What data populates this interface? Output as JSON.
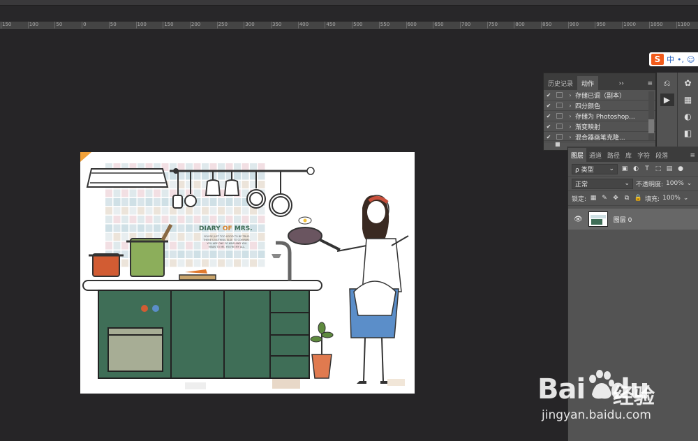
{
  "ruler": {
    "labels": [
      "150",
      "100",
      "50",
      "0",
      "50",
      "100",
      "150",
      "200",
      "250",
      "300",
      "350",
      "400",
      "450",
      "500",
      "550",
      "600",
      "650",
      "700",
      "750",
      "800",
      "850",
      "900",
      "950",
      "1000",
      "1050",
      "1100"
    ]
  },
  "ime": {
    "logo": "S",
    "lang": "中",
    "dots": "•,",
    "smile": "☺"
  },
  "actions_panel": {
    "tabs": [
      "历史记录",
      "动作"
    ],
    "more": "››",
    "menu": "≡",
    "rows": [
      {
        "label": "存储已调（副本）",
        "checked": true
      },
      {
        "label": "四分颜色",
        "checked": true
      },
      {
        "label": "存储为 Photoshop...",
        "checked": true
      },
      {
        "label": "渐变映射",
        "checked": true
      },
      {
        "label": "混合器画笔克隆...",
        "checked": true
      }
    ]
  },
  "layers_panel": {
    "tabs": [
      "图层",
      "通道",
      "路径",
      "库",
      "字符",
      "段落"
    ],
    "menu": "≡",
    "filter_label": "ρ 类型",
    "blend_mode": "正常",
    "opacity_label": "不透明度:",
    "opacity_value": "100%",
    "lock_label": "锁定:",
    "fill_label": "填充:",
    "fill_value": "100%",
    "layer_name": "图层 0"
  },
  "artwork": {
    "title_a": "DIARY",
    "title_b": " OF ",
    "title_c": "MRS.",
    "line1": "YOU'RE JUST TOO GOOD TO BE TRUE.",
    "line2": "THERE'S NOTHING ELSE TO COMPARE.",
    "line3": "YOU ARE ONE OF KIND AND YOU",
    "line4": "MEAN TO ME. YOU'RE MY ALL."
  },
  "watermark": {
    "brand": "Bai",
    "brand2": "du",
    "cn": "经验",
    "url": "jingyan.baidu.com"
  },
  "colors": {
    "background": "#262527",
    "panel": "#535353",
    "accent_green": "#3f6e57",
    "apron_blue": "#5b8ec9"
  }
}
